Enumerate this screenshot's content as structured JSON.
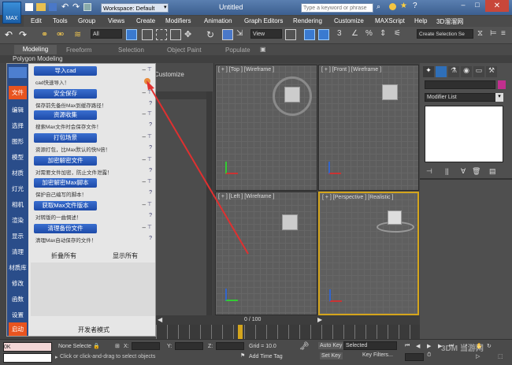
{
  "titlebar": {
    "app_badge": "MAX",
    "workspace": "Workspace: Default",
    "doc_title": "Untitled",
    "search_placeholder": "Type a keyword or phrase"
  },
  "menu": [
    "Edit",
    "Tools",
    "Group",
    "Views",
    "Create",
    "Modifiers",
    "Animation",
    "Graph Editors",
    "Rendering",
    "Customize",
    "MAXScript",
    "Help",
    "3D溜溜网"
  ],
  "toolbar": {
    "filter_value": "All",
    "ref_coord_value": "View",
    "selection_set_placeholder": "Create Selection Se"
  },
  "ribbon": {
    "tabs": [
      "Modeling",
      "Freeform",
      "Selection",
      "Object Paint",
      "Populate"
    ],
    "sub_label": "Polygon Modeling"
  },
  "customize_label": "Customize",
  "viewports": {
    "top": "[ + ] [Top ] [Wireframe ]",
    "front": "[ + ] [Front ] [Wireframe ]",
    "left": "[ + ] [Left ] [Wireframe ]",
    "perspective": "[ + ] [Perspective ] [Realistic ]"
  },
  "cmdpanel": {
    "modifier_list": "Modifier List"
  },
  "plugin": {
    "sidetabs": [
      "文件",
      "编辑",
      "选择",
      "图形",
      "模型",
      "材质",
      "灯光",
      "相机",
      "渲染",
      "显示",
      "清理",
      "材质库",
      "修改",
      "函数",
      "设置",
      "启动"
    ],
    "entries": [
      {
        "button": "导入cad",
        "desc": "cad快速导入！"
      },
      {
        "button": "安全保存",
        "desc": "保存前先备份Max到缓存路径！"
      },
      {
        "button": "资源收集",
        "desc": "搜索Max文件时会保存文件！"
      },
      {
        "button": "打包场景",
        "desc": "资源打包，比Max默认的快N倍！"
      },
      {
        "button": "加密解密文件",
        "desc": "对需要文件加密，防止文件泄露！"
      },
      {
        "button": "加密解密Max脚本",
        "desc": "保护自己编写的脚本！"
      },
      {
        "button": "获取Max文件版本",
        "desc": "对转版的一曲惆述！"
      },
      {
        "button": "清理备份文件",
        "desc": "清理Max自动保存的文件！"
      }
    ],
    "collapse_all": "折叠所有",
    "show_all": "显示所有",
    "developer_mode": "开发者模式"
  },
  "timeline": {
    "frame_counter": "0 / 100"
  },
  "statusbar": {
    "maxscript_value": "0K",
    "selection": "None Selecte",
    "x_label": "X:",
    "y_label": "Y:",
    "z_label": "Z:",
    "grid": "Grid = 10.0",
    "auto_key": "Auto Key",
    "selected_value": "Selected",
    "set_key": "Set Key",
    "key_filters": "Key Filters...",
    "prompt": "Click or click-and-drag to select objects",
    "add_time_tag": "Add Time Tag"
  },
  "watermark": "3DM 当游网"
}
